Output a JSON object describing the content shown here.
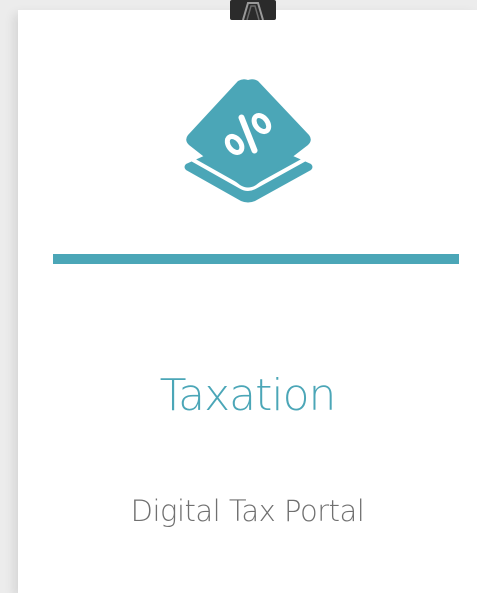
{
  "card": {
    "title": "Taxation",
    "subtitle": "Digital Tax Portal",
    "icon": "percent-tag-icon",
    "clip_icon": "binder-clip-icon"
  },
  "colors": {
    "accent": "#4ba6b7",
    "subtitle_text": "#707070",
    "card_background": "#ffffff",
    "page_background": "#ececec"
  }
}
